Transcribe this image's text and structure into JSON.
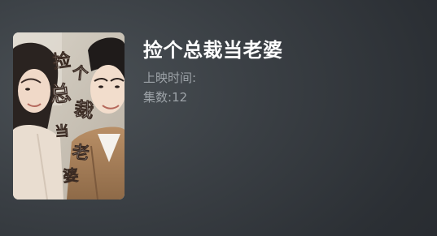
{
  "drama": {
    "title": "捡个总裁当老婆",
    "release_label": "上映时间:",
    "release_value": "",
    "episodes_label": "集数:",
    "episodes_value": "12",
    "poster_calligraphy": "捡个总裁当老婆"
  },
  "colors": {
    "background": "#2f3338",
    "title": "#ffffff",
    "meta": "#9da3a8"
  }
}
